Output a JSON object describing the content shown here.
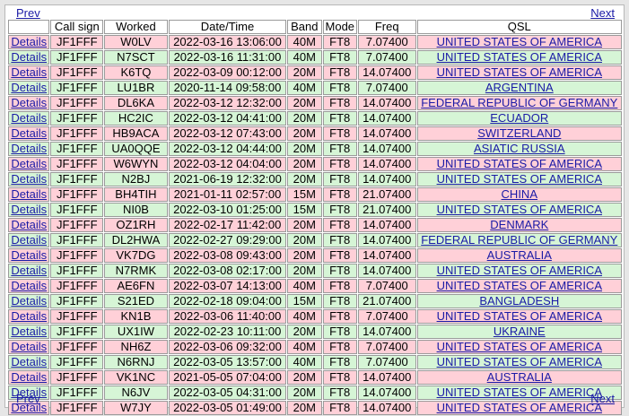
{
  "nav": {
    "prev": "Prev",
    "next": "Next"
  },
  "headers": [
    "",
    "Call sign",
    "Worked",
    "Date/Time",
    "Band",
    "Mode",
    "Freq",
    "QSL"
  ],
  "details_label": "Details",
  "colors": {
    "pink": "#ffd0d8",
    "green": "#d6f5d6",
    "link": "#1a1aa6"
  },
  "rows": [
    {
      "call": "JF1FFF",
      "worked": "W0LV",
      "datetime": "2022-03-16 13:06:00",
      "band": "40M",
      "mode": "FT8",
      "freq": "7.07400",
      "qsl": "UNITED STATES OF AMERICA",
      "color": "pink"
    },
    {
      "call": "JF1FFF",
      "worked": "N7SCT",
      "datetime": "2022-03-16 11:31:00",
      "band": "40M",
      "mode": "FT8",
      "freq": "7.07400",
      "qsl": "UNITED STATES OF AMERICA",
      "color": "green"
    },
    {
      "call": "JF1FFF",
      "worked": "K6TQ",
      "datetime": "2022-03-09 00:12:00",
      "band": "20M",
      "mode": "FT8",
      "freq": "14.07400",
      "qsl": "UNITED STATES OF AMERICA",
      "color": "pink"
    },
    {
      "call": "JF1FFF",
      "worked": "LU1BR",
      "datetime": "2020-11-14 09:58:00",
      "band": "40M",
      "mode": "FT8",
      "freq": "7.07400",
      "qsl": "ARGENTINA",
      "color": "green"
    },
    {
      "call": "JF1FFF",
      "worked": "DL6KA",
      "datetime": "2022-03-12 12:32:00",
      "band": "20M",
      "mode": "FT8",
      "freq": "14.07400",
      "qsl": "FEDERAL REPUBLIC OF GERMANY",
      "color": "pink"
    },
    {
      "call": "JF1FFF",
      "worked": "HC2IC",
      "datetime": "2022-03-12 04:41:00",
      "band": "20M",
      "mode": "FT8",
      "freq": "14.07400",
      "qsl": "ECUADOR",
      "color": "green"
    },
    {
      "call": "JF1FFF",
      "worked": "HB9ACA",
      "datetime": "2022-03-12 07:43:00",
      "band": "20M",
      "mode": "FT8",
      "freq": "14.07400",
      "qsl": "SWITZERLAND",
      "color": "pink"
    },
    {
      "call": "JF1FFF",
      "worked": "UA0QQE",
      "datetime": "2022-03-12 04:44:00",
      "band": "20M",
      "mode": "FT8",
      "freq": "14.07400",
      "qsl": "ASIATIC RUSSIA",
      "color": "green"
    },
    {
      "call": "JF1FFF",
      "worked": "W6WYN",
      "datetime": "2022-03-12 04:04:00",
      "band": "20M",
      "mode": "FT8",
      "freq": "14.07400",
      "qsl": "UNITED STATES OF AMERICA",
      "color": "pink"
    },
    {
      "call": "JF1FFF",
      "worked": "N2BJ",
      "datetime": "2021-06-19 12:32:00",
      "band": "20M",
      "mode": "FT8",
      "freq": "14.07400",
      "qsl": "UNITED STATES OF AMERICA",
      "color": "green"
    },
    {
      "call": "JF1FFF",
      "worked": "BH4TIH",
      "datetime": "2021-01-11 02:57:00",
      "band": "15M",
      "mode": "FT8",
      "freq": "21.07400",
      "qsl": "CHINA",
      "color": "pink"
    },
    {
      "call": "JF1FFF",
      "worked": "NI0B",
      "datetime": "2022-03-10 01:25:00",
      "band": "15M",
      "mode": "FT8",
      "freq": "21.07400",
      "qsl": "UNITED STATES OF AMERICA",
      "color": "green"
    },
    {
      "call": "JF1FFF",
      "worked": "OZ1RH",
      "datetime": "2022-02-17 11:42:00",
      "band": "20M",
      "mode": "FT8",
      "freq": "14.07400",
      "qsl": "DENMARK",
      "color": "pink"
    },
    {
      "call": "JF1FFF",
      "worked": "DL2HWA",
      "datetime": "2022-02-27 09:29:00",
      "band": "20M",
      "mode": "FT8",
      "freq": "14.07400",
      "qsl": "FEDERAL REPUBLIC OF GERMANY",
      "color": "green"
    },
    {
      "call": "JF1FFF",
      "worked": "VK7DG",
      "datetime": "2022-03-08 09:43:00",
      "band": "20M",
      "mode": "FT8",
      "freq": "14.07400",
      "qsl": "AUSTRALIA",
      "color": "pink"
    },
    {
      "call": "JF1FFF",
      "worked": "N7RMK",
      "datetime": "2022-03-08 02:17:00",
      "band": "20M",
      "mode": "FT8",
      "freq": "14.07400",
      "qsl": "UNITED STATES OF AMERICA",
      "color": "green"
    },
    {
      "call": "JF1FFF",
      "worked": "AE6FN",
      "datetime": "2022-03-07 14:13:00",
      "band": "40M",
      "mode": "FT8",
      "freq": "7.07400",
      "qsl": "UNITED STATES OF AMERICA",
      "color": "pink"
    },
    {
      "call": "JF1FFF",
      "worked": "S21ED",
      "datetime": "2022-02-18 09:04:00",
      "band": "15M",
      "mode": "FT8",
      "freq": "21.07400",
      "qsl": "BANGLADESH",
      "color": "green"
    },
    {
      "call": "JF1FFF",
      "worked": "KN1B",
      "datetime": "2022-03-06 11:40:00",
      "band": "40M",
      "mode": "FT8",
      "freq": "7.07400",
      "qsl": "UNITED STATES OF AMERICA",
      "color": "pink"
    },
    {
      "call": "JF1FFF",
      "worked": "UX1IW",
      "datetime": "2022-02-23 10:11:00",
      "band": "20M",
      "mode": "FT8",
      "freq": "14.07400",
      "qsl": "UKRAINE",
      "color": "green"
    },
    {
      "call": "JF1FFF",
      "worked": "NH6Z",
      "datetime": "2022-03-06 09:32:00",
      "band": "40M",
      "mode": "FT8",
      "freq": "7.07400",
      "qsl": "UNITED STATES OF AMERICA",
      "color": "pink"
    },
    {
      "call": "JF1FFF",
      "worked": "N6RNJ",
      "datetime": "2022-03-05 13:57:00",
      "band": "40M",
      "mode": "FT8",
      "freq": "7.07400",
      "qsl": "UNITED STATES OF AMERICA",
      "color": "green"
    },
    {
      "call": "JF1FFF",
      "worked": "VK1NC",
      "datetime": "2021-05-05 07:04:00",
      "band": "20M",
      "mode": "FT8",
      "freq": "14.07400",
      "qsl": "AUSTRALIA",
      "color": "pink"
    },
    {
      "call": "JF1FFF",
      "worked": "N6JV",
      "datetime": "2022-03-05 04:31:00",
      "band": "20M",
      "mode": "FT8",
      "freq": "14.07400",
      "qsl": "UNITED STATES OF AMERICA",
      "color": "green"
    },
    {
      "call": "JF1FFF",
      "worked": "W7JY",
      "datetime": "2022-03-05 01:49:00",
      "band": "20M",
      "mode": "FT8",
      "freq": "14.07400",
      "qsl": "UNITED STATES OF AMERICA",
      "color": "pink"
    }
  ]
}
